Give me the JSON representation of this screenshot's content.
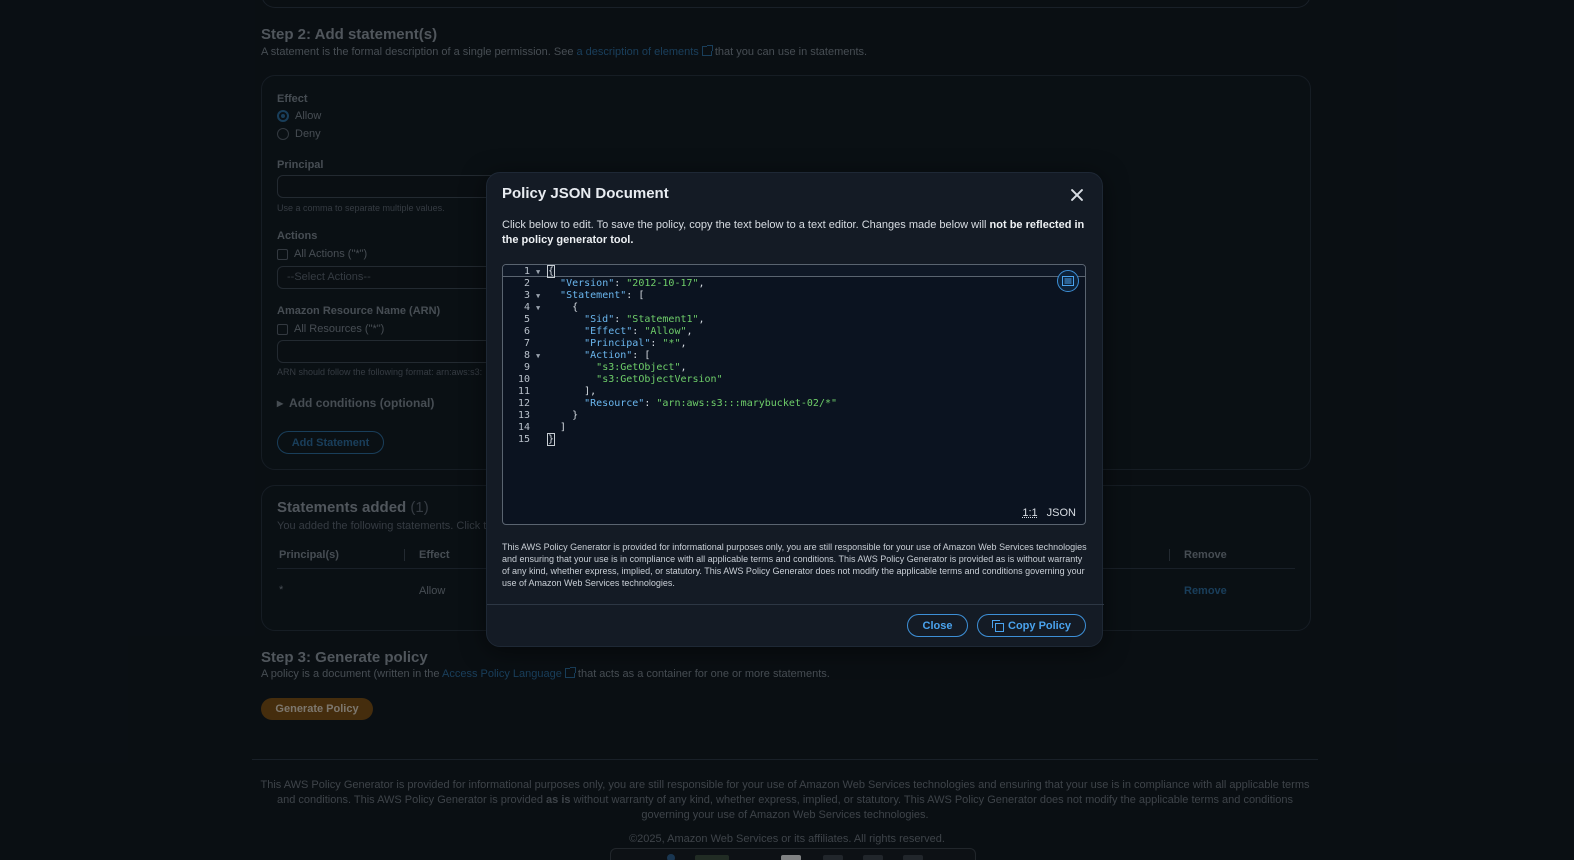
{
  "step2": {
    "title": "Step 2: Add statement(s)",
    "desc_before": "A statement is the formal description of a single permission. See ",
    "desc_link": "a description of elements",
    "desc_after": " that you can use in statements."
  },
  "form": {
    "effect_label": "Effect",
    "effect_options": [
      "Allow",
      "Deny"
    ],
    "effect_selected": "Allow",
    "principal_label": "Principal",
    "principal_hint": "Use a comma to separate multiple values.",
    "actions_label": "Actions",
    "all_actions": "All Actions (\"*\")",
    "select_actions_placeholder": "--Select Actions--",
    "arn_label": "Amazon Resource Name (ARN)",
    "all_resources": "All Resources (\"*\")",
    "arn_hint": "ARN should follow the following format: arn:aws:s3:",
    "conditions": "Add conditions (optional)",
    "add_statement": "Add Statement"
  },
  "statements": {
    "title": "Statements added",
    "count": "(1)",
    "desc": "You added the following statements. Click the",
    "headers": [
      "Principal(s)",
      "Effect",
      "Remove"
    ],
    "row": {
      "principal": "*",
      "effect": "Allow",
      "remove": "Remove"
    }
  },
  "step3": {
    "title": "Step 3: Generate policy",
    "desc_before": "A policy is a document (written in the ",
    "desc_link": "Access Policy Language",
    "desc_after": " that acts as a container for one or more statements.",
    "button": "Generate Policy"
  },
  "footer": {
    "text_1": "This AWS Policy Generator is provided for informational purposes only, you are still responsible for your use of Amazon Web Services technologies and ensuring that your use is in compliance with all applicable terms and conditions. This AWS Policy Generator is provided ",
    "text_bold": "as is",
    "text_2": " without warranty of any kind, whether express, implied, or statutory. This AWS Policy Generator does not modify the applicable terms and conditions governing your use of Amazon Web Services technologies.",
    "copyright": "©2025, Amazon Web Services or its affiliates. All rights reserved."
  },
  "modal": {
    "title": "Policy JSON Document",
    "desc_plain": "Click below to edit. To save the policy, copy the text below to a text editor. Changes made below will ",
    "desc_bold": "not be reflected in the policy generator tool.",
    "editor": {
      "lines": [
        {
          "n": "1",
          "fold": true,
          "parts": [
            [
              "p",
              "{"
            ]
          ]
        },
        {
          "n": "2",
          "fold": false,
          "parts": [
            [
              "p",
              "  "
            ],
            [
              "k",
              "\"Version\""
            ],
            [
              "p",
              ": "
            ],
            [
              "s",
              "\"2012-10-17\""
            ],
            [
              "p",
              ","
            ]
          ]
        },
        {
          "n": "3",
          "fold": true,
          "parts": [
            [
              "p",
              "  "
            ],
            [
              "k",
              "\"Statement\""
            ],
            [
              "p",
              ": ["
            ]
          ]
        },
        {
          "n": "4",
          "fold": true,
          "parts": [
            [
              "p",
              "    {"
            ]
          ]
        },
        {
          "n": "5",
          "fold": false,
          "parts": [
            [
              "p",
              "      "
            ],
            [
              "k",
              "\"Sid\""
            ],
            [
              "p",
              ": "
            ],
            [
              "s",
              "\"Statement1\""
            ],
            [
              "p",
              ","
            ]
          ]
        },
        {
          "n": "6",
          "fold": false,
          "parts": [
            [
              "p",
              "      "
            ],
            [
              "k",
              "\"Effect\""
            ],
            [
              "p",
              ": "
            ],
            [
              "s",
              "\"Allow\""
            ],
            [
              "p",
              ","
            ]
          ]
        },
        {
          "n": "7",
          "fold": false,
          "parts": [
            [
              "p",
              "      "
            ],
            [
              "k",
              "\"Principal\""
            ],
            [
              "p",
              ": "
            ],
            [
              "s",
              "\"*\""
            ],
            [
              "p",
              ","
            ]
          ]
        },
        {
          "n": "8",
          "fold": true,
          "parts": [
            [
              "p",
              "      "
            ],
            [
              "k",
              "\"Action\""
            ],
            [
              "p",
              ": ["
            ]
          ]
        },
        {
          "n": "9",
          "fold": false,
          "parts": [
            [
              "p",
              "        "
            ],
            [
              "s",
              "\"s3:GetObject\""
            ],
            [
              "p",
              ","
            ]
          ]
        },
        {
          "n": "10",
          "fold": false,
          "parts": [
            [
              "p",
              "        "
            ],
            [
              "s",
              "\"s3:GetObjectVersion\""
            ]
          ]
        },
        {
          "n": "11",
          "fold": false,
          "parts": [
            [
              "p",
              "      ],"
            ]
          ]
        },
        {
          "n": "12",
          "fold": false,
          "parts": [
            [
              "p",
              "      "
            ],
            [
              "k",
              "\"Resource\""
            ],
            [
              "p",
              ": "
            ],
            [
              "s",
              "\"arn:aws:s3:::marybucket-02/*\""
            ]
          ]
        },
        {
          "n": "13",
          "fold": false,
          "parts": [
            [
              "p",
              "    }"
            ]
          ]
        },
        {
          "n": "14",
          "fold": false,
          "parts": [
            [
              "p",
              "  ]"
            ]
          ]
        },
        {
          "n": "15",
          "fold": false,
          "parts": [
            [
              "p",
              "}"
            ]
          ]
        }
      ],
      "cursor_position": "1:1",
      "language": "JSON"
    },
    "disclaimer": "This AWS Policy Generator is provided for informational purposes only, you are still responsible for your use of Amazon Web Services technologies and ensuring that your use is in compliance with all applicable terms and conditions. This AWS Policy Generator is provided as is without warranty of any kind, whether express, implied, or statutory. This AWS Policy Generator does not modify the applicable terms and conditions governing your use of Amazon Web Services technologies.",
    "close_button": "Close",
    "copy_button": "Copy Policy"
  },
  "colors": {
    "accent": "#3d8fd6",
    "json_key": "#6bb7ef",
    "json_string": "#6fcf6a",
    "generate_button": "#7a4c10"
  }
}
